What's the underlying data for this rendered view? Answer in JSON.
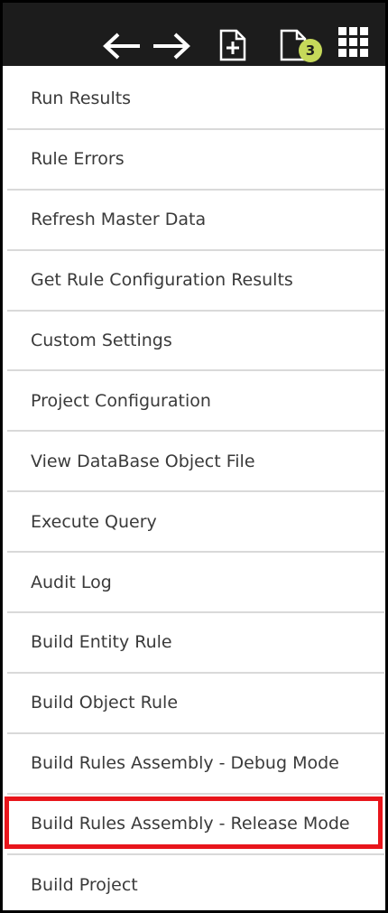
{
  "toolbar": {
    "icons": [
      "arrow-left-icon",
      "arrow-right-icon",
      "new-document-icon",
      "documents-icon",
      "grid-menu-icon"
    ],
    "documents_badge": "3",
    "colors": {
      "background": "#1c1c1c",
      "icon": "#ffffff",
      "badge": "#c6d95a"
    }
  },
  "menu": {
    "items": [
      {
        "label": "Run Results"
      },
      {
        "label": "Rule Errors"
      },
      {
        "label": "Refresh Master Data"
      },
      {
        "label": "Get Rule Configuration Results"
      },
      {
        "label": "Custom Settings"
      },
      {
        "label": "Project Configuration"
      },
      {
        "label": "View DataBase Object File"
      },
      {
        "label": "Execute Query"
      },
      {
        "label": "Audit Log"
      },
      {
        "label": "Build Entity Rule"
      },
      {
        "label": "Build Object Rule"
      },
      {
        "label": "Build Rules Assembly - Debug Mode"
      },
      {
        "label": "Build Rules Assembly - Release Mode",
        "highlighted": true
      },
      {
        "label": "Build Project"
      }
    ],
    "highlight_color": "#e8151b"
  }
}
